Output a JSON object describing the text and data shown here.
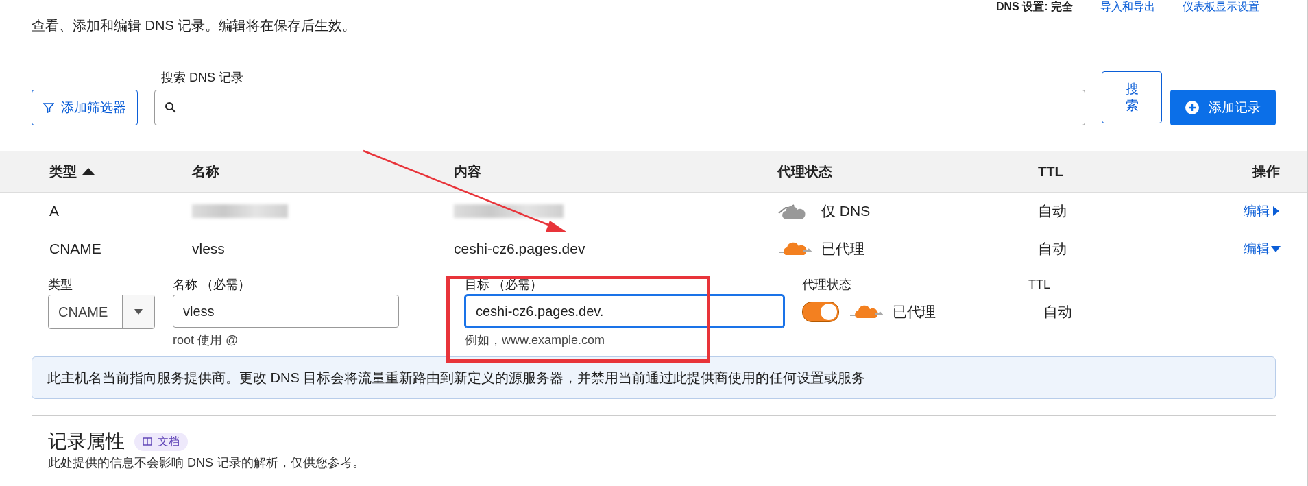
{
  "top_links": [
    {
      "text": "DNS 设置: 完全",
      "kind": "label"
    },
    {
      "text": "导入和导出",
      "kind": "link"
    },
    {
      "text": "仪表板显示设置",
      "kind": "link"
    }
  ],
  "description": "查看、添加和编辑 DNS 记录。编辑将在保存后生效。",
  "filter_button": "添加筛选器",
  "search": {
    "label": "搜索 DNS 记录"
  },
  "search_button": "搜索",
  "add_button": "添加记录",
  "table": {
    "columns": [
      {
        "label": "类型",
        "sorted": true
      },
      {
        "label": "名称",
        "sorted": false
      },
      {
        "label": "内容",
        "sorted": false
      },
      {
        "label": "代理状态",
        "sorted": false
      },
      {
        "label": "TTL",
        "sorted": false
      },
      {
        "label": "操作",
        "sorted": false
      }
    ],
    "rows": [
      {
        "type": "A",
        "name": {
          "blurred": true
        },
        "content": {
          "blurred": true
        },
        "proxied": false,
        "proxy_label": "仅 DNS",
        "ttl": "自动",
        "action": "编辑",
        "expanded": false
      },
      {
        "type": "CNAME",
        "name": {
          "text": "vless",
          "blurred": false
        },
        "content": {
          "text": "ceshi-cz6.pages.dev",
          "blurred": false
        },
        "proxied": true,
        "proxy_label": "已代理",
        "ttl": "自动",
        "action": "编辑",
        "expanded": true
      }
    ]
  },
  "edit_form": {
    "type_label": "类型",
    "type_value": "CNAME",
    "name_label": "名称 （必需）",
    "name_value": "vless",
    "name_hint": "root 使用 @",
    "target_label": "目标 （必需）",
    "target_value": "ceshi-cz6.pages.dev.",
    "target_hint": "例如，www.example.com",
    "proxy_label": "代理状态",
    "proxy_on": true,
    "proxy_text": "已代理",
    "ttl_label": "TTL",
    "ttl_value": "自动"
  },
  "notice": "此主机名当前指向服务提供商。更改 DNS 目标会将流量重新路由到新定义的源服务器，并禁用当前通过此提供商使用的任何设置或服务",
  "section": {
    "title": "记录属性",
    "badge": "文档",
    "subtitle": "此处提供的信息不会影响 DNS 记录的解析，仅供您参考。"
  }
}
